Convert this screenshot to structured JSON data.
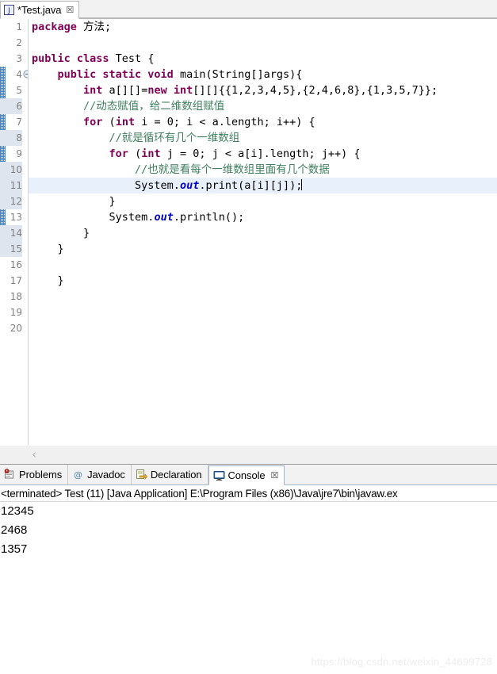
{
  "editor": {
    "tab": {
      "icon": "java-file-icon",
      "label": "*Test.java",
      "close": "☒"
    },
    "gutter": {
      "fold_marker_line": 4,
      "change_bar_from_line": 4,
      "change_bar_to_line": 15,
      "line_numbers": [
        "1",
        "2",
        "3",
        "4",
        "5",
        "6",
        "7",
        "8",
        "9",
        "10",
        "11",
        "12",
        "13",
        "14",
        "15",
        "16",
        "17",
        "18",
        "19",
        "20"
      ],
      "highlighted_line_numbers": [
        "6",
        "8",
        "10",
        "11",
        "12",
        "14",
        "15"
      ]
    },
    "current_line": 11,
    "lines": [
      {
        "n": 1,
        "tokens": [
          {
            "t": "kw",
            "v": "package"
          },
          {
            "t": "plain",
            "v": " 方法;"
          }
        ]
      },
      {
        "n": 2,
        "tokens": []
      },
      {
        "n": 3,
        "tokens": [
          {
            "t": "kw",
            "v": "public class"
          },
          {
            "t": "plain",
            "v": " Test {"
          }
        ]
      },
      {
        "n": 4,
        "tokens": [
          {
            "t": "plain",
            "v": "    "
          },
          {
            "t": "kw",
            "v": "public static void"
          },
          {
            "t": "plain",
            "v": " main(String[]args){"
          }
        ]
      },
      {
        "n": 5,
        "tokens": [
          {
            "t": "plain",
            "v": "        "
          },
          {
            "t": "kw",
            "v": "int"
          },
          {
            "t": "plain",
            "v": " a[][]="
          },
          {
            "t": "kw",
            "v": "new int"
          },
          {
            "t": "plain",
            "v": "[][]{{1,2,3,4,5},{2,4,6,8},{1,3,5,7}};"
          }
        ]
      },
      {
        "n": 6,
        "tokens": [
          {
            "t": "plain",
            "v": "        "
          },
          {
            "t": "cmt",
            "v": "//动态赋值，给二维数组赋值"
          }
        ]
      },
      {
        "n": 7,
        "tokens": [
          {
            "t": "plain",
            "v": "        "
          },
          {
            "t": "kw",
            "v": "for"
          },
          {
            "t": "plain",
            "v": " ("
          },
          {
            "t": "kw",
            "v": "int"
          },
          {
            "t": "plain",
            "v": " i = 0; i < a.length; i++) {"
          }
        ]
      },
      {
        "n": 8,
        "tokens": [
          {
            "t": "plain",
            "v": "            "
          },
          {
            "t": "cmt",
            "v": "//就是循环有几个一维数组"
          }
        ]
      },
      {
        "n": 9,
        "tokens": [
          {
            "t": "plain",
            "v": "            "
          },
          {
            "t": "kw",
            "v": "for"
          },
          {
            "t": "plain",
            "v": " ("
          },
          {
            "t": "kw",
            "v": "int"
          },
          {
            "t": "plain",
            "v": " j = 0; j < a[i].length; j++) {"
          }
        ]
      },
      {
        "n": 10,
        "tokens": [
          {
            "t": "plain",
            "v": "                "
          },
          {
            "t": "cmt",
            "v": "//也就是看每个一维数组里面有几个数据"
          }
        ]
      },
      {
        "n": 11,
        "tokens": [
          {
            "t": "plain",
            "v": "                System."
          },
          {
            "t": "fld",
            "v": "out"
          },
          {
            "t": "plain",
            "v": ".print(a[i][j]);"
          },
          {
            "t": "caret",
            "v": ""
          }
        ]
      },
      {
        "n": 12,
        "tokens": [
          {
            "t": "plain",
            "v": "            }"
          }
        ]
      },
      {
        "n": 13,
        "tokens": [
          {
            "t": "plain",
            "v": "            System."
          },
          {
            "t": "fld",
            "v": "out"
          },
          {
            "t": "plain",
            "v": ".println();"
          }
        ]
      },
      {
        "n": 14,
        "tokens": [
          {
            "t": "plain",
            "v": "        }"
          }
        ]
      },
      {
        "n": 15,
        "tokens": [
          {
            "t": "plain",
            "v": "    }"
          }
        ]
      },
      {
        "n": 16,
        "tokens": []
      },
      {
        "n": 17,
        "tokens": [
          {
            "t": "plain",
            "v": "    }"
          }
        ]
      },
      {
        "n": 18,
        "tokens": []
      },
      {
        "n": 19,
        "tokens": []
      },
      {
        "n": 20,
        "tokens": []
      }
    ],
    "hscroll": {
      "left_arrow": "‹"
    }
  },
  "bottom_panel": {
    "tabs": [
      {
        "icon": "problems-icon",
        "label": "Problems",
        "active": false,
        "close": ""
      },
      {
        "icon": "javadoc-icon",
        "label": "Javadoc",
        "active": false,
        "close": ""
      },
      {
        "icon": "declaration-icon",
        "label": "Declaration",
        "active": false,
        "close": ""
      },
      {
        "icon": "console-icon",
        "label": "Console",
        "active": true,
        "close": "☒"
      }
    ],
    "console": {
      "header": "<terminated> Test (11) [Java Application] E:\\Program Files (x86)\\Java\\jre7\\bin\\javaw.ex",
      "output": [
        "12345",
        "2468",
        "1357"
      ]
    }
  },
  "watermark": "https://blog.csdn.net/weixin_44699728",
  "colors": {
    "keyword": "#7F0055",
    "comment": "#3F7F5F",
    "static_field": "#0000C0",
    "line_number": "#808080",
    "highlight_line": "#E8F0FB",
    "change_bar": "#3F7FBF"
  }
}
